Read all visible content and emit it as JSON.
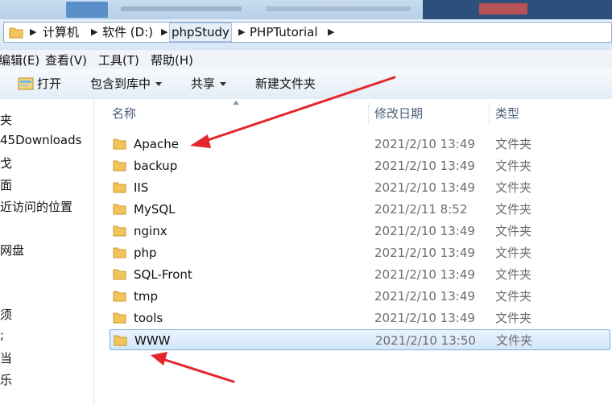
{
  "address": {
    "crumbs": [
      "计算机",
      "软件 (D:)",
      "phpStudy",
      "PHPTutorial"
    ]
  },
  "menu": [
    "编辑(E)",
    "查看(V)",
    "工具(T)",
    "帮助(H)"
  ],
  "toolbar": {
    "open": "打开",
    "include_library": "包含到库中",
    "share": "共享",
    "new_folder": "新建文件夹"
  },
  "nav": {
    "items": [
      "夹",
      "45Downloads",
      "戈",
      "面",
      "近访问的位置",
      "网盘",
      "须",
      ";",
      "当",
      "乐"
    ]
  },
  "columns": {
    "name": "名称",
    "date": "修改日期",
    "type": "类型"
  },
  "files": [
    {
      "name": "Apache",
      "date": "2021/2/10 13:49",
      "type": "文件夹"
    },
    {
      "name": "backup",
      "date": "2021/2/10 13:49",
      "type": "文件夹"
    },
    {
      "name": "IIS",
      "date": "2021/2/10 13:49",
      "type": "文件夹"
    },
    {
      "name": "MySQL",
      "date": "2021/2/11 8:52",
      "type": "文件夹"
    },
    {
      "name": "nginx",
      "date": "2021/2/10 13:49",
      "type": "文件夹"
    },
    {
      "name": "php",
      "date": "2021/2/10 13:49",
      "type": "文件夹"
    },
    {
      "name": "SQL-Front",
      "date": "2021/2/10 13:49",
      "type": "文件夹"
    },
    {
      "name": "tmp",
      "date": "2021/2/10 13:49",
      "type": "文件夹"
    },
    {
      "name": "tools",
      "date": "2021/2/10 13:49",
      "type": "文件夹"
    },
    {
      "name": "WWW",
      "date": "2021/2/10 13:50",
      "type": "文件夹"
    }
  ],
  "selected": "WWW",
  "colors": {
    "annotation_arrow": "#e3262b",
    "folder": "#f3c45a",
    "selection": "#d3e6fb"
  },
  "icons": [
    "folder-icon",
    "open-icon",
    "annotation-arrow"
  ]
}
